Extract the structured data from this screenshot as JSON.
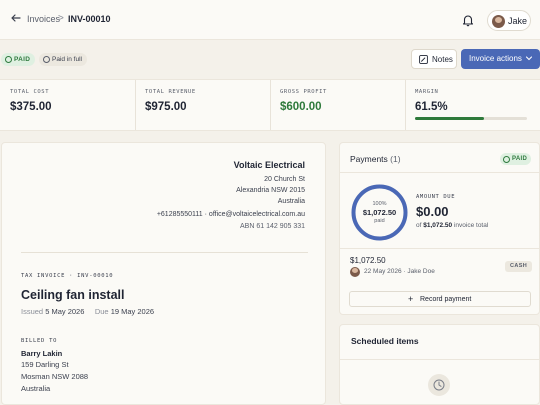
{
  "header": {
    "breadcrumb_parent": "Invoices",
    "breadcrumb_separator": ">",
    "breadcrumb_current": "INV-00010",
    "user_name": "Jake"
  },
  "status": {
    "paid_badge": "PAID",
    "paid_in_full_badge": "Paid in full",
    "notes_label": "Notes",
    "actions_label": "Invoice actions"
  },
  "stats": [
    {
      "label": "Total cost",
      "value": "$375.00",
      "tone": "default"
    },
    {
      "label": "Total revenue",
      "value": "$975.00",
      "tone": "default"
    },
    {
      "label": "Gross profit",
      "value": "$600.00",
      "tone": "green"
    },
    {
      "label": "Margin",
      "value": "61.5%",
      "tone": "default",
      "progress": 0.615
    }
  ],
  "invoice": {
    "company": "Voltaic Electrical",
    "address_lines": [
      "20 Church St",
      "Alexandria NSW 2015",
      "Australia"
    ],
    "contact": "+61285550111 · office@voltaicelectrical.com.au",
    "abn": "ABN 61 142 905 331",
    "kicker": "TAX INVOICE · INV-00010",
    "title": "Ceiling fan install",
    "issued_label": "Issued",
    "issued_date": "5 May 2026",
    "due_label": "Due",
    "due_date": "19 May 2026",
    "billed_to_label": "BILLED TO",
    "billed_name": "Barry Lakin",
    "billed_lines": [
      "159 Darling St",
      "Mosman NSW 2088",
      "Australia"
    ]
  },
  "payments": {
    "title": "Payments",
    "count": "(1)",
    "badge": "PAID",
    "ring_percent_label": "100%",
    "ring_amount": "$1,072.50",
    "ring_sub": "paid",
    "ring_progress": 1.0,
    "amount_due_label": "AMOUNT DUE",
    "amount_due": "$0.00",
    "of_prefix": "of",
    "invoice_total": "$1,072.50",
    "of_suffix": "invoice total",
    "entry": {
      "amount": "$1,072.50",
      "meta": "22 May 2026 · Jake Doe",
      "method": "CASH"
    },
    "record_label": "Record payment"
  },
  "scheduled": {
    "title": "Scheduled items"
  },
  "colors": {
    "accent": "#4a68b6",
    "success": "#2e7a3b",
    "background": "#f4f1ea"
  }
}
